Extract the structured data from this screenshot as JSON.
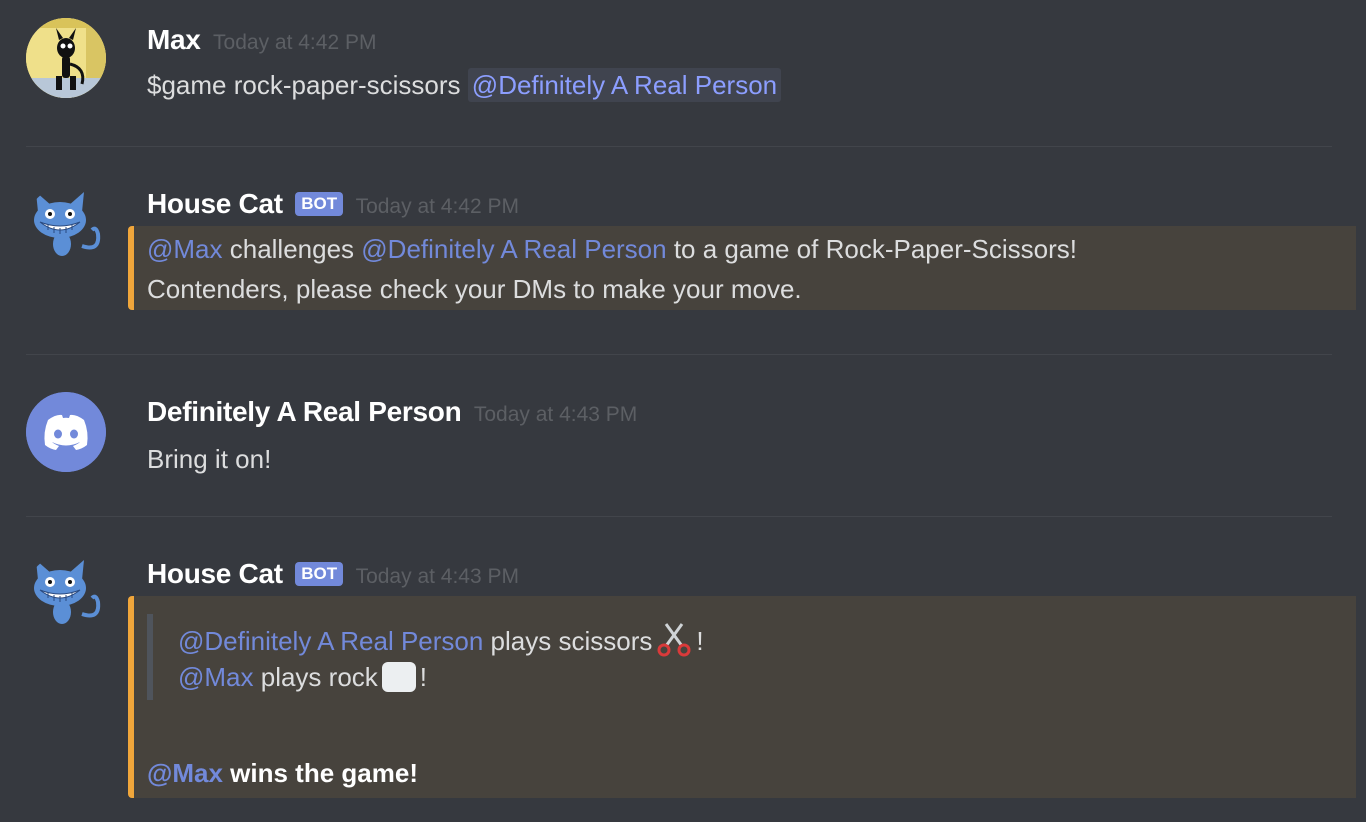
{
  "messages": [
    {
      "username": "Max",
      "timestamp": "Today at 4:42 PM",
      "content_prefix": "$game rock-paper-scissors",
      "mention": "@Definitely A Real Person"
    },
    {
      "username": "House Cat",
      "bot_tag": "BOT",
      "timestamp": "Today at 4:42 PM",
      "embed": {
        "line1_mention1": "@Max",
        "line1_text1": " challenges ",
        "line1_mention2": "@Definitely A Real Person",
        "line1_text2": " to a game of Rock-Paper-Scissors!",
        "line2": "Contenders, please check your DMs to make your move."
      }
    },
    {
      "username": "Definitely A Real Person",
      "timestamp": "Today at 4:43 PM",
      "content": "Bring it on!"
    },
    {
      "username": "House Cat",
      "bot_tag": "BOT",
      "timestamp": "Today at 4:43 PM",
      "embed": {
        "quote1_mention": "@Definitely A Real Person",
        "quote1_text": " plays scissors",
        "quote1_end": "!",
        "quote2_mention": "@Max",
        "quote2_text": " plays rock",
        "quote2_end": "!",
        "result_mention": "@Max",
        "result_text": " wins the game!"
      }
    }
  ],
  "icons": {
    "avatar_max": "cat-cartoon-avatar",
    "avatar_housecat": "grinning-cat-icon",
    "avatar_discord": "discord-logo-icon",
    "scissors": "scissors-emoji",
    "rock": "rock-emoji"
  },
  "colors": {
    "background": "#36393f",
    "mention": "#7289da",
    "embed_accent": "#f0a63b",
    "embed_bg": "#47433d",
    "bot_tag": "#7289da",
    "discord_blurple": "#7289da"
  }
}
